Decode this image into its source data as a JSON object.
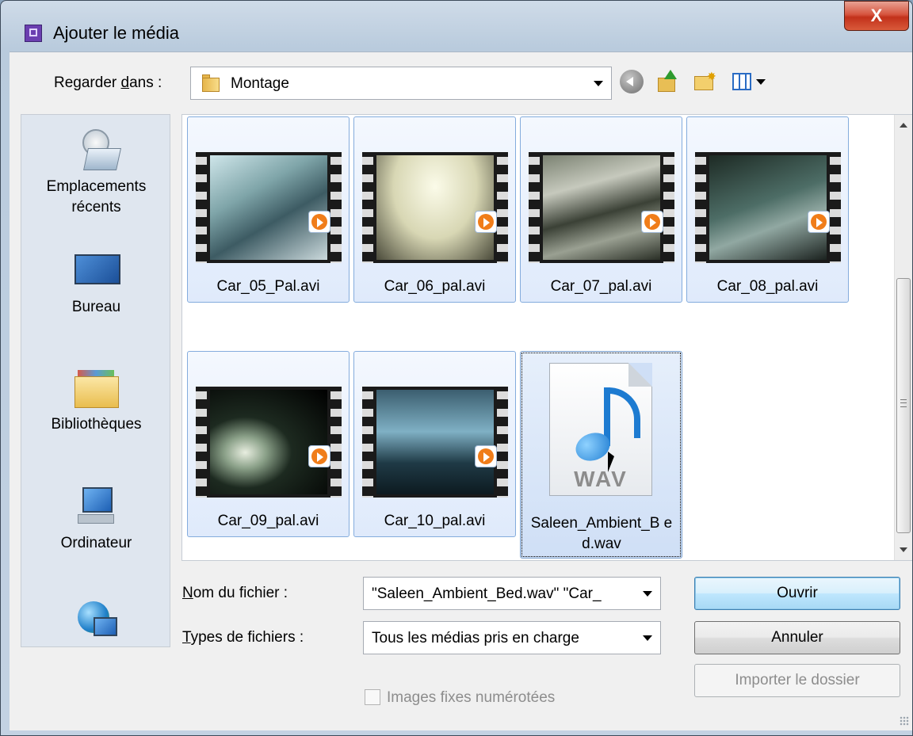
{
  "window": {
    "title": "Ajouter le média",
    "close_label": "X"
  },
  "toolbar": {
    "look_in_label": "Regarder dans :",
    "look_in_value": "Montage"
  },
  "places": [
    {
      "label": "Emplacements récents",
      "icon": "recent-places-icon"
    },
    {
      "label": "Bureau",
      "icon": "desktop-icon"
    },
    {
      "label": "Bibliothèques",
      "icon": "libraries-icon"
    },
    {
      "label": "Ordinateur",
      "icon": "computer-icon"
    },
    {
      "label": "",
      "icon": "network-icon"
    }
  ],
  "files": [
    {
      "name": "Car_05_Pal.avi",
      "type": "video"
    },
    {
      "name": "Car_06_pal.avi",
      "type": "video"
    },
    {
      "name": "Car_07_pal.avi",
      "type": "video"
    },
    {
      "name": "Car_08_pal.avi",
      "type": "video"
    },
    {
      "name": "Car_09_pal.avi",
      "type": "video"
    },
    {
      "name": "Car_10_pal.avi",
      "type": "video"
    },
    {
      "name": "Saleen_Ambient_B ed.wav",
      "type": "audio",
      "icon_text": "WAV"
    }
  ],
  "form": {
    "file_name_label": "Nom du fichier :",
    "file_name_value": "\"Saleen_Ambient_Bed.wav\" \"Car_",
    "file_types_label": "Types de fichiers :",
    "file_types_value": "Tous les médias pris en charge",
    "numbered_stills_label": "Images fixes numérotées",
    "numbered_stills_checked": false
  },
  "buttons": {
    "open": "Ouvrir",
    "cancel": "Annuler",
    "import_folder": "Importer le dossier"
  }
}
